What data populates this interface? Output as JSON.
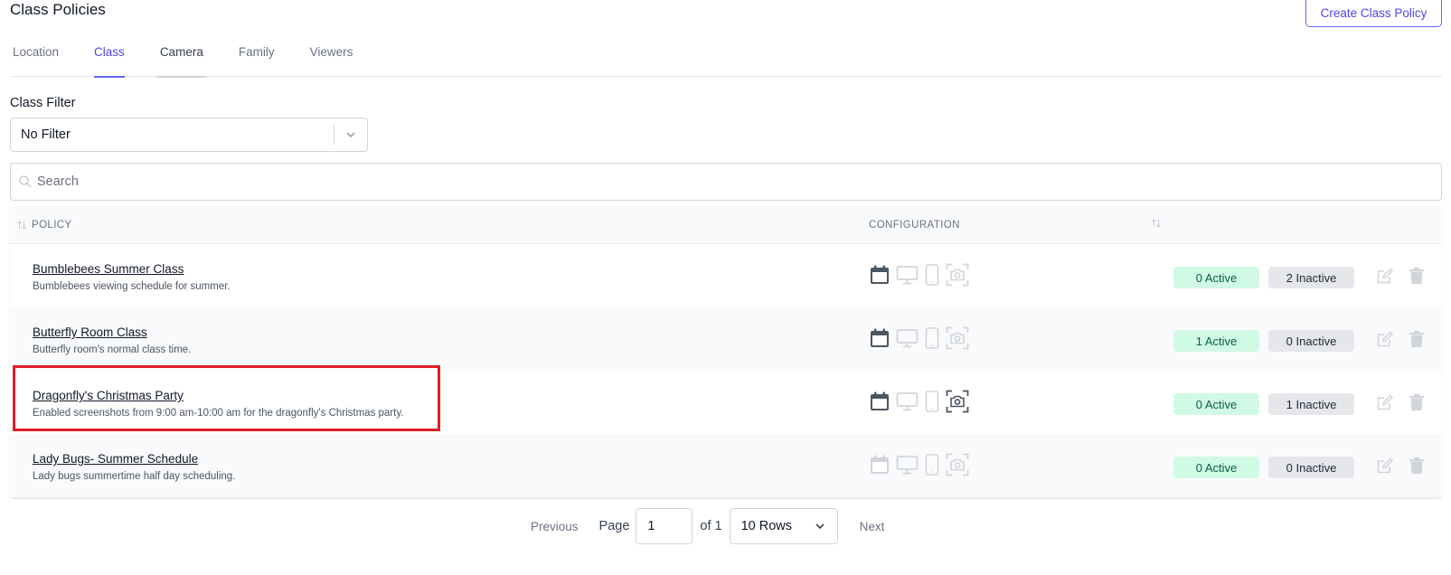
{
  "header": {
    "title": "Class Policies",
    "create_button": "Create Class Policy"
  },
  "tabs": [
    {
      "label": "Location",
      "state": "default"
    },
    {
      "label": "Class",
      "state": "active"
    },
    {
      "label": "Camera",
      "state": "hover"
    },
    {
      "label": "Family",
      "state": "default"
    },
    {
      "label": "Viewers",
      "state": "default"
    }
  ],
  "filter": {
    "label": "Class Filter",
    "value": "No Filter"
  },
  "search": {
    "placeholder": "Search"
  },
  "table": {
    "columns": {
      "policy": "POLICY",
      "configuration": "CONFIGURATION"
    },
    "rows": [
      {
        "name": "Bumblebees Summer Class",
        "description": "Bumblebees viewing schedule for summer.",
        "active": "0 Active",
        "inactive": "2 Inactive",
        "config": {
          "schedule": true,
          "desktop": false,
          "mobile": false,
          "screenshot": false
        }
      },
      {
        "name": "Butterfly Room Class",
        "description": "Butterfly room's normal class time.",
        "active": "1 Active",
        "inactive": "0 Inactive",
        "config": {
          "schedule": true,
          "desktop": false,
          "mobile": false,
          "screenshot": false
        }
      },
      {
        "name": "Dragonfly's Christmas Party",
        "description": "Enabled screenshots from 9:00 am-10:00 am for the dragonfly's Christmas party.",
        "active": "0 Active",
        "inactive": "1 Inactive",
        "config": {
          "schedule": true,
          "desktop": false,
          "mobile": false,
          "screenshot": true
        }
      },
      {
        "name": "Lady Bugs- Summer Schedule",
        "description": "Lady bugs summertime half day scheduling.",
        "active": "0 Active",
        "inactive": "0 Inactive",
        "config": {
          "schedule": false,
          "desktop": false,
          "mobile": false,
          "screenshot": false
        }
      }
    ]
  },
  "pagination": {
    "previous": "Previous",
    "page_label": "Page",
    "page_value": "1",
    "of_label": "of 1",
    "rows_label": "10 Rows",
    "next": "Next"
  },
  "colors": {
    "accent": "#4f46e5",
    "active_badge": "#d1fae5",
    "inactive_badge": "#e5e7eb",
    "highlight": "#e11d2a",
    "icon_on": "#4b5563",
    "icon_off": "#d1d5db"
  }
}
